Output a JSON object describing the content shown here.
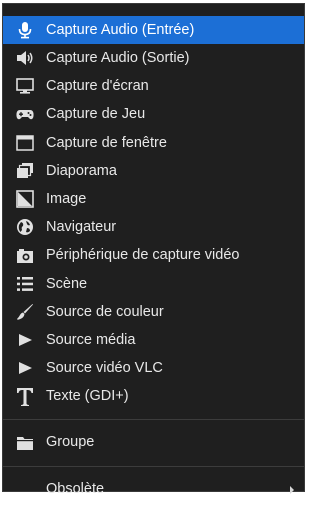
{
  "menu": {
    "items": [
      {
        "label": "Capture Audio (Entrée)",
        "icon": "microphone-icon"
      },
      {
        "label": "Capture Audio (Sortie)",
        "icon": "speaker-icon"
      },
      {
        "label": "Capture d'écran",
        "icon": "monitor-icon"
      },
      {
        "label": "Capture de Jeu",
        "icon": "gamepad-icon"
      },
      {
        "label": "Capture de fenêtre",
        "icon": "window-icon"
      },
      {
        "label": "Diaporama",
        "icon": "slideshow-icon"
      },
      {
        "label": "Image",
        "icon": "image-icon"
      },
      {
        "label": "Navigateur",
        "icon": "globe-icon"
      },
      {
        "label": "Périphérique de capture vidéo",
        "icon": "camera-icon"
      },
      {
        "label": "Scène",
        "icon": "list-icon"
      },
      {
        "label": "Source de couleur",
        "icon": "brush-icon"
      },
      {
        "label": "Source média",
        "icon": "play-icon"
      },
      {
        "label": "Source vidéo VLC",
        "icon": "play-icon"
      },
      {
        "label": "Texte (GDI+)",
        "icon": "text-icon"
      },
      {
        "label": "Groupe",
        "icon": "folder-icon"
      },
      {
        "label": "Obsolète",
        "icon": "none"
      }
    ],
    "selected_index": 0,
    "colors": {
      "background": "#1f1f1f",
      "selected": "#1c6fd6",
      "text": "#e8e8e8"
    }
  }
}
